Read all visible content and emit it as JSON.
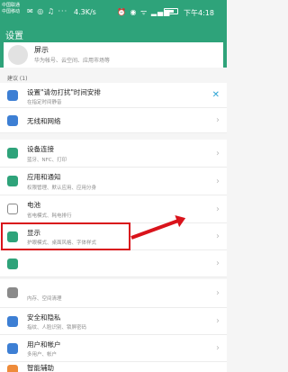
{
  "status": {
    "carrier_1": "中国联通",
    "carrier_2": "中国移动",
    "left_icons": "✉ ◎ ♫ ···",
    "speed": "4.3K/s",
    "right_icons": "⏰ ◉ ᯤ ▂▄▆",
    "time": "下午4:18"
  },
  "header": {
    "title": "设置"
  },
  "account": {
    "title": "屏示",
    "subtitle": "华为帐号、云空间、应用市场等"
  },
  "suggestions": {
    "label": "建议 (1)",
    "item": {
      "title": "设置\"请勿打扰\"时间安排",
      "subtitle": "在指定时间静音"
    }
  },
  "rows": [
    {
      "title": "无线和网络",
      "subtitle": ""
    },
    {
      "title": "设备连接",
      "subtitle": "蓝牙、NFC、打印"
    },
    {
      "title": "应用和通知",
      "subtitle": "权限管理、默认应用、应用分身"
    },
    {
      "title": "电池",
      "subtitle": "省电模式、耗电排行"
    },
    {
      "title": "显示",
      "subtitle": "护眼模式、桌面风格、字体样式"
    },
    {
      "title": "",
      "subtitle": ""
    },
    {
      "title": "",
      "subtitle": "内存、空间清理"
    },
    {
      "title": "安全和隐私",
      "subtitle": "指纹、人脸识别、锁屏密码"
    },
    {
      "title": "用户和帐户",
      "subtitle": "多用户、帐户"
    },
    {
      "title": "智能辅助",
      "subtitle": ""
    }
  ],
  "colors": {
    "accent": "#2ea37a",
    "highlight": "#d9131b"
  }
}
